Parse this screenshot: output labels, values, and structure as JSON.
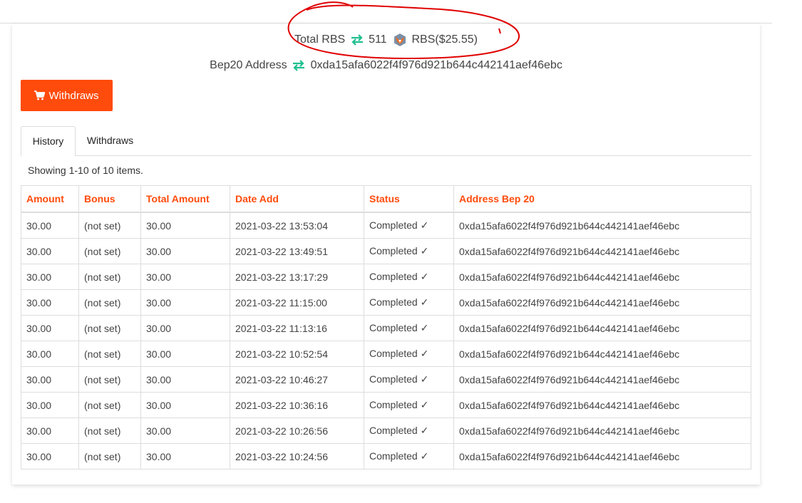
{
  "balance": {
    "total_label": "Total RBS",
    "amount": "511",
    "token_label": "RBS($25.55)",
    "bep20_label": "Bep20 Address",
    "bep20_address": "0xda15afa6022f4f976d921b644c442141aef46ebc",
    "arrow_color": "#1fbf8f"
  },
  "actions": {
    "withdraws_button": "Withdraws"
  },
  "tabs": [
    {
      "label": "History",
      "active": true
    },
    {
      "label": "Withdraws",
      "active": false
    }
  ],
  "summary": "Showing 1-10 of 10 items.",
  "table": {
    "headers": [
      "Amount",
      "Bonus",
      "Total Amount",
      "Date Add",
      "Status",
      "Address Bep 20"
    ],
    "header_color": "#ff4b0b",
    "rows": [
      [
        "30.00",
        "(not set)",
        "30.00",
        "2021-03-22 13:53:04",
        "Completed ✓",
        "0xda15afa6022f4f976d921b644c442141aef46ebc"
      ],
      [
        "30.00",
        "(not set)",
        "30.00",
        "2021-03-22 13:49:51",
        "Completed ✓",
        "0xda15afa6022f4f976d921b644c442141aef46ebc"
      ],
      [
        "30.00",
        "(not set)",
        "30.00",
        "2021-03-22 13:17:29",
        "Completed ✓",
        "0xda15afa6022f4f976d921b644c442141aef46ebc"
      ],
      [
        "30.00",
        "(not set)",
        "30.00",
        "2021-03-22 11:15:00",
        "Completed ✓",
        "0xda15afa6022f4f976d921b644c442141aef46ebc"
      ],
      [
        "30.00",
        "(not set)",
        "30.00",
        "2021-03-22 11:13:16",
        "Completed ✓",
        "0xda15afa6022f4f976d921b644c442141aef46ebc"
      ],
      [
        "30.00",
        "(not set)",
        "30.00",
        "2021-03-22 10:52:54",
        "Completed ✓",
        "0xda15afa6022f4f976d921b644c442141aef46ebc"
      ],
      [
        "30.00",
        "(not set)",
        "30.00",
        "2021-03-22 10:46:27",
        "Completed ✓",
        "0xda15afa6022f4f976d921b644c442141aef46ebc"
      ],
      [
        "30.00",
        "(not set)",
        "30.00",
        "2021-03-22 10:36:16",
        "Completed ✓",
        "0xda15afa6022f4f976d921b644c442141aef46ebc"
      ],
      [
        "30.00",
        "(not set)",
        "30.00",
        "2021-03-22 10:26:56",
        "Completed ✓",
        "0xda15afa6022f4f976d921b644c442141aef46ebc"
      ],
      [
        "30.00",
        "(not set)",
        "30.00",
        "2021-03-22 10:24:56",
        "Completed ✓",
        "0xda15afa6022f4f976d921b644c442141aef46ebc"
      ]
    ]
  },
  "icons": {
    "transfer": "transfer-arrows-icon",
    "token": "fox-token-icon",
    "cart": "shopping-cart-icon"
  },
  "annotation_color": "#e00000"
}
